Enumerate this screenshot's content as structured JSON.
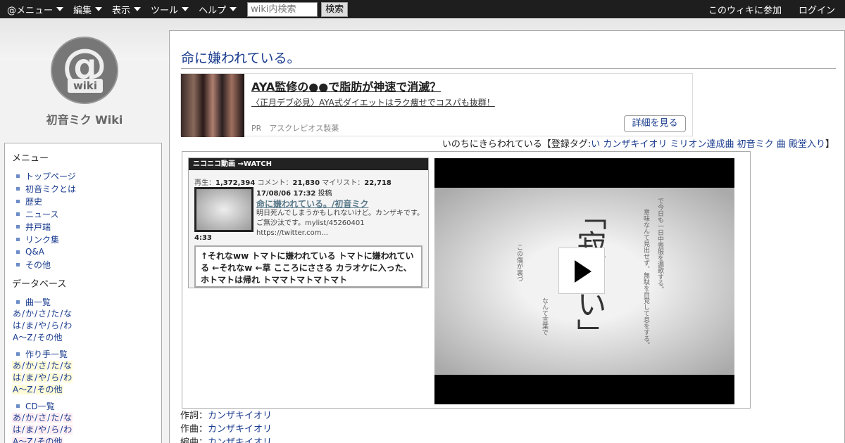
{
  "topbar": {
    "menus": [
      "@メニュー",
      "編集",
      "表示",
      "ツール",
      "ヘルプ"
    ],
    "search_placeholder": "wiki内検索",
    "search_button": "検索",
    "join": "このウィキに参加",
    "login": "ログイン"
  },
  "logo": {
    "at": "@",
    "wiki": "wiki"
  },
  "site_title": "初音ミク Wiki",
  "sidebar": {
    "menu_heading": "メニュー",
    "menu_items": [
      "トップページ",
      "初音ミクとは",
      "歴史",
      "ニュース",
      "井戸端",
      "リンク集",
      "Q&A",
      "その他"
    ],
    "database_heading": "データベース",
    "groups": [
      {
        "label": "曲一覧",
        "rows": [
          [
            "あ",
            "か",
            "さ",
            "た",
            "な"
          ],
          [
            "は",
            "ま",
            "や",
            "ら",
            "わ"
          ],
          [
            "A～Z",
            "その他"
          ]
        ]
      },
      {
        "label": "作り手一覧",
        "rows": [
          [
            "あ",
            "か",
            "さ",
            "た",
            "な"
          ],
          [
            "は",
            "ま",
            "や",
            "ら",
            "わ"
          ],
          [
            "A～Z",
            "その他"
          ]
        ]
      },
      {
        "label": "CD一覧",
        "rows": [
          [
            "あ",
            "か",
            "さ",
            "た",
            "な"
          ],
          [
            "は",
            "ま",
            "や",
            "ら",
            "わ"
          ],
          [
            "A～Z",
            "その他"
          ]
        ]
      }
    ]
  },
  "page": {
    "title": "命に嫌われている。",
    "ad": {
      "title": "AYA監修の●●で脂肪が神速で消滅？",
      "desc": "〈正月デブ必見〉AYA式ダイエットはラク痩せでコスパも抜群！",
      "pr": "PR　アスクレピオス製薬",
      "button": "詳細を見る"
    },
    "tagline": {
      "prefix": "いのちにきらわれている【登録タグ:",
      "tags": [
        "い",
        "カンザキイオリ",
        "ミリオン達成曲",
        "初音ミク",
        "曲",
        "殿堂入り"
      ],
      "suffix": "】"
    },
    "nico": {
      "bar": "ニコニコ動画 →WATCH",
      "views_label": "再生：",
      "views": "1,372,394",
      "comments_label": "コメント：",
      "comments": "21,830",
      "mylist_label": "マイリスト：",
      "mylist": "22,718",
      "date": "17/08/06 17:32",
      "date_suffix": "投稿",
      "video_title": "命に嫌われている。/初音ミク",
      "description": "明日死んでしまうかもしれないけど。カンザキです。ご無沙汰です。mylist/45260401 https://twitter.com...",
      "duration": "4:33",
      "comment_stream": "↑それなww トマトに嫌われている トマトに嫌われている ←それなw ←草 こころにささる カラオケに入った、ホトマトは帰れ トママトマトマトマト"
    },
    "player": {
      "kanji": "「寂しい」",
      "line1": "で今日も一日中喪服を漏歌する。",
      "line2": "意味なんて見出せず、無駄を自覚して息をする。",
      "line3": "この傷が裏づ",
      "line4": "なんて言葉で"
    },
    "credits": [
      {
        "label": "作詞：",
        "value": "カンザキイオリ"
      },
      {
        "label": "作曲：",
        "value": "カンザキイオリ"
      },
      {
        "label": "編曲：",
        "value": "カンザキイオリ"
      }
    ]
  }
}
